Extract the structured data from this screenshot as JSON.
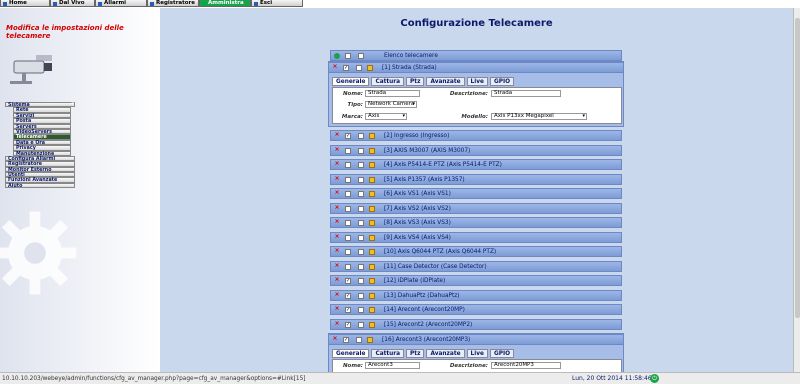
{
  "nav": [
    "Home",
    "Dal Vivo",
    "Allarmi",
    "Registratore",
    "Amministra",
    "Esci"
  ],
  "sidebar": {
    "title": "Modifica le impostazioni delle telecamere",
    "menu": [
      {
        "label": "Sistema",
        "sub": false
      },
      {
        "label": "Rete",
        "sub": true
      },
      {
        "label": "Servizi",
        "sub": true
      },
      {
        "label": "Posta",
        "sub": true
      },
      {
        "label": "Servers",
        "sub": true
      },
      {
        "label": "VideoServers",
        "sub": true
      },
      {
        "label": "Telecamere",
        "sub": true,
        "selected": true
      },
      {
        "label": "Data e Ora",
        "sub": true
      },
      {
        "label": "Privacy",
        "sub": true
      },
      {
        "label": "Manutenzione",
        "sub": true
      },
      {
        "label": "Configura Allarmi",
        "sub": false
      },
      {
        "label": "Registratore",
        "sub": false
      },
      {
        "label": "Monitor Esterno",
        "sub": false
      },
      {
        "label": "Utenti",
        "sub": false
      },
      {
        "label": "Funzioni Avanzate",
        "sub": false
      },
      {
        "label": "Aiuto",
        "sub": false
      }
    ]
  },
  "main": {
    "title": "Configurazione Telecamere",
    "list_header": "Elenco telecamere",
    "tabs": [
      "Generale",
      "Cattura",
      "Ptz",
      "Avanzate",
      "Live",
      "GPIO"
    ],
    "expanded1": {
      "label": "[1] Strada (Strada)",
      "nome_label": "Nome:",
      "nome": "Strada",
      "desc_label": "Descrizione:",
      "desc": "Strada",
      "tipo_label": "Tipo:",
      "tipo": "Network Camera",
      "marca_label": "Marca:",
      "marca": "Axis",
      "modello_label": "Modello:",
      "modello": "Axis P13xx Megapixel"
    },
    "cameras": [
      {
        "label": "[2] Ingresso (Ingresso)",
        "checked": true
      },
      {
        "label": "[3] AXIS M3007 (AXIS M3007)",
        "checked": false
      },
      {
        "label": "[4] Axis P5414-E PTZ (Axis P5414-E PTZ)",
        "checked": false
      },
      {
        "label": "[5] Axis P1357 (Axis P1357)",
        "checked": false
      },
      {
        "label": "[6] Axis VS1 (Axis VS1)",
        "checked": false
      },
      {
        "label": "[7] Axis VS2 (Axis VS2)",
        "checked": false
      },
      {
        "label": "[8] Axis VS3 (Axis VS3)",
        "checked": false
      },
      {
        "label": "[9] Axis VS4 (Axis VS4)",
        "checked": false
      },
      {
        "label": "[10] Axis Q6044 PTZ (Axis Q6044 PTZ)",
        "checked": false
      },
      {
        "label": "[11] Case Detector (Case Detector)",
        "checked": false
      },
      {
        "label": "[12] iDPlate (iDPlate)",
        "checked": true
      },
      {
        "label": "[13] DahuaPtz (DahuaPtz)",
        "checked": true
      },
      {
        "label": "[14] Arecont (Arecont20MP)",
        "checked": true
      },
      {
        "label": "[15] Arecont2 (Arecont20MP2)",
        "checked": true
      }
    ],
    "expanded16": {
      "label": "[16] Arecont3 (Arecont20MP3)",
      "nome_label": "Nome:",
      "nome": "Arecont3",
      "desc_label": "Descrizione:",
      "desc": "Arecont20MP3"
    }
  },
  "status": {
    "url": "10.10.10.203/webeye/admin/functions/cfg_av_manager.php?page=cfg_av_manager&options=#Link[15]",
    "clock": "Lun, 20 Ott 2014 11:58:46"
  },
  "colors": {
    "accent": "#1aa34a",
    "title": "#0c1a6a",
    "row": "#8eabe0",
    "sidebar_title": "#d40000"
  }
}
